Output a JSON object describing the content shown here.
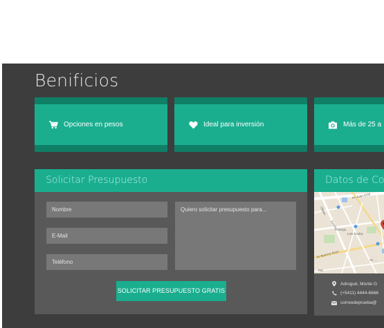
{
  "section": {
    "title": "Benificios"
  },
  "features": [
    {
      "label": "Opciones en pesos",
      "icon": "cart-icon"
    },
    {
      "label": "Ideal para inversión",
      "icon": "heart-icon"
    },
    {
      "label": "Más de 25 a",
      "icon": "camera-icon"
    }
  ],
  "quote_form": {
    "title": "Solicitar Presupuesto",
    "name_placeholder": "Nombre",
    "email_placeholder": "E-Mail",
    "phone_placeholder": "Teléfono",
    "message_placeholder": "Quiero solicitar presupuesto para...",
    "submit_label": "SOLICITAR PRESUPUESTO GRATIS"
  },
  "contact": {
    "title": "Datos de Co",
    "map_labels": {
      "road1": "Av Juan XXIII",
      "road2": "Luis Godoy",
      "road3": "Av Buenos Aires",
      "road4": "Pat",
      "road5": "Zuviria",
      "road6": "Dorrego",
      "road7": "Oliden",
      "road8": "Av. ..."
    },
    "address": "Adrogué, Monte G",
    "phone": "(+5411) 4444-6666",
    "email": "correodeprueba@"
  },
  "colors": {
    "accent": "#1aae8f",
    "accent_dark": "#0f7f66",
    "background": "#3d3d3d",
    "panel": "#595959",
    "field": "#787878"
  }
}
